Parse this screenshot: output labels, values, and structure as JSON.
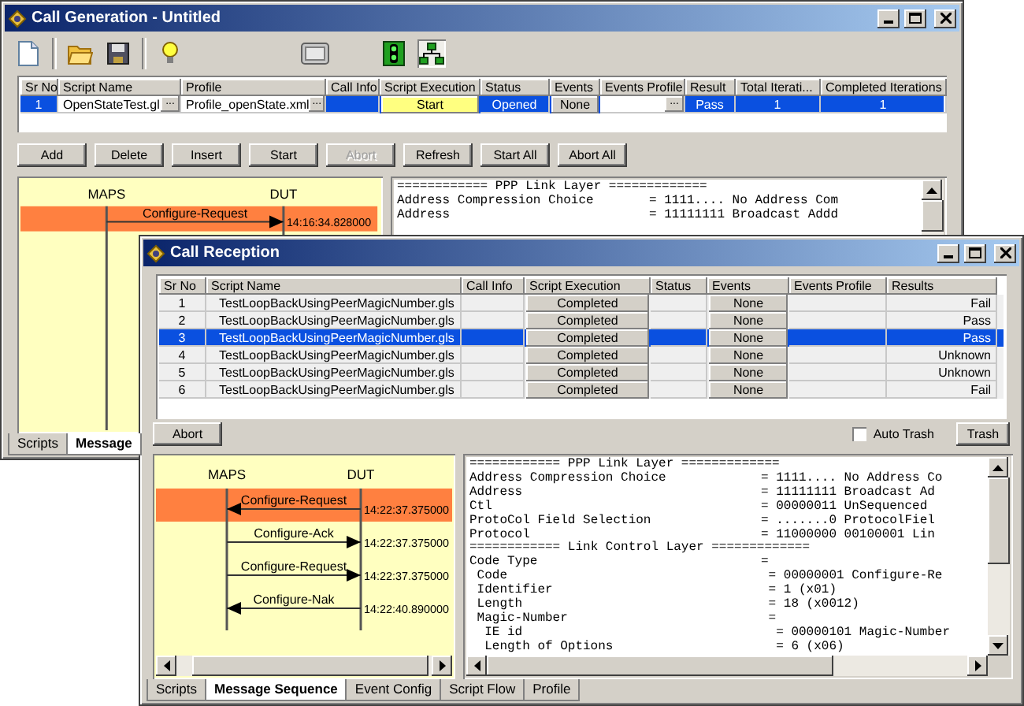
{
  "back_window": {
    "title": "Call Generation - Untitled",
    "table": {
      "columns": [
        "Sr No",
        "Script Name",
        "Profile",
        "Call Info",
        "Script Execution",
        "Status",
        "Events",
        "Events Profile",
        "Result",
        "Total Iterati...",
        "Completed Iterations"
      ],
      "rows": [
        {
          "sr_no": "1",
          "script_name": "OpenStateTest.gl",
          "profile": "Profile_openState.xml",
          "script_execution": "Start",
          "status": "Opened",
          "events": "None",
          "result": "Pass",
          "total_iterations": "1",
          "completed_iterations": "1",
          "selected": true
        }
      ]
    },
    "browse_label": "...",
    "buttons": [
      {
        "label": "Add",
        "disabled": false
      },
      {
        "label": "Delete",
        "disabled": false
      },
      {
        "label": "Insert",
        "disabled": false
      },
      {
        "label": "Start",
        "disabled": false
      },
      {
        "label": "Abort",
        "disabled": true
      },
      {
        "label": "Refresh",
        "disabled": false
      },
      {
        "label": "Start All",
        "disabled": false
      },
      {
        "label": "Abort All",
        "disabled": false
      }
    ],
    "sequence": {
      "left_label": "MAPS",
      "right_label": "DUT",
      "messages": [
        {
          "label": "Configure-Request",
          "time": "14:16:34.828000",
          "kind": "outgoing",
          "selected": true
        }
      ]
    },
    "decode_lines": [
      {
        "field": "============ PPP Link Layer ============",
        "value": "="
      },
      {
        "field": "Address Compression Choice",
        "value": "= 1111.... No Address Com"
      },
      {
        "field": "Address",
        "value": "= 11111111 Broadcast Addd"
      }
    ],
    "tabs": [
      {
        "label": "Scripts",
        "selected": false
      },
      {
        "label": "Message",
        "selected": true
      }
    ]
  },
  "front_window": {
    "title": "Call Reception",
    "table": {
      "columns": [
        "Sr No",
        "Script Name",
        "Call Info",
        "Script Execution",
        "Status",
        "Events",
        "Events Profile",
        "Results"
      ],
      "rows": [
        {
          "sr_no": "1",
          "script_name": "TestLoopBackUsingPeerMagicNumber.gls",
          "script_execution": "Completed",
          "events": "None",
          "results": "Fail",
          "selected": false
        },
        {
          "sr_no": "2",
          "script_name": "TestLoopBackUsingPeerMagicNumber.gls",
          "script_execution": "Completed",
          "events": "None",
          "results": "Pass",
          "selected": false
        },
        {
          "sr_no": "3",
          "script_name": "TestLoopBackUsingPeerMagicNumber.gls",
          "script_execution": "Completed",
          "events": "None",
          "results": "Pass",
          "selected": true
        },
        {
          "sr_no": "4",
          "script_name": "TestLoopBackUsingPeerMagicNumber.gls",
          "script_execution": "Completed",
          "events": "None",
          "results": "Unknown",
          "selected": false
        },
        {
          "sr_no": "5",
          "script_name": "TestLoopBackUsingPeerMagicNumber.gls",
          "script_execution": "Completed",
          "events": "None",
          "results": "Unknown",
          "selected": false
        },
        {
          "sr_no": "6",
          "script_name": "TestLoopBackUsingPeerMagicNumber.gls",
          "script_execution": "Completed",
          "events": "None",
          "results": "Fail",
          "selected": false
        }
      ]
    },
    "abort_button": "Abort",
    "auto_trash": {
      "label": "Auto Trash",
      "checked": false
    },
    "trash_button": "Trash",
    "sequence": {
      "left_label": "MAPS",
      "right_label": "DUT",
      "messages": [
        {
          "label": "Configure-Request",
          "time": "14:22:37.375000",
          "kind": "incoming",
          "selected": true
        },
        {
          "label": "Configure-Ack",
          "time": "14:22:37.375000",
          "kind": "outgoing",
          "selected": false
        },
        {
          "label": "Configure-Request",
          "time": "14:22:37.375000",
          "kind": "outgoing",
          "selected": false
        },
        {
          "label": "Configure-Nak",
          "time": "14:22:40.890000",
          "kind": "incoming",
          "selected": false
        }
      ]
    },
    "decode_lines": [
      {
        "field": "============ PPP Link Layer ============",
        "value": "="
      },
      {
        "field": "Address Compression Choice",
        "value": "= 1111.... No Address Co"
      },
      {
        "field": "Address",
        "value": "= 11111111 Broadcast Ad"
      },
      {
        "field": "Ctl",
        "value": "= 00000011 UnSequenced"
      },
      {
        "field": "ProtoCol Field Selection",
        "value": "= .......0 ProtocolFiel"
      },
      {
        "field": "Protocol",
        "value": "= 11000000 00100001 Lin"
      },
      {
        "field": "============ Link Control Layer ============",
        "value": "="
      },
      {
        "field": "Code Type",
        "value": "=",
        "children": [
          {
            "field": "Code",
            "value": "= 00000001 Configure-Re"
          },
          {
            "field": "Identifier",
            "value": "= 1 (x01)"
          },
          {
            "field": "Length",
            "value": "= 18 (x0012)"
          },
          {
            "field": "Magic-Number",
            "value": "=",
            "children": [
              {
                "field": "IE id",
                "value": "= 00000101 Magic-Number"
              },
              {
                "field": "Length of Options",
                "value": "= 6 (x06)"
              }
            ]
          }
        ]
      }
    ],
    "tabs": [
      {
        "label": "Scripts",
        "selected": false
      },
      {
        "label": "Message Sequence",
        "selected": true
      },
      {
        "label": "Event Config",
        "selected": false
      },
      {
        "label": "Script Flow",
        "selected": false
      },
      {
        "label": "Profile",
        "selected": false
      }
    ]
  }
}
